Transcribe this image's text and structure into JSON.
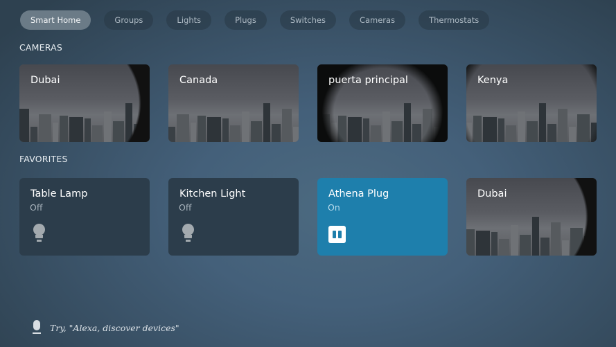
{
  "tabs": [
    {
      "label": "Smart Home",
      "active": true
    },
    {
      "label": "Groups",
      "active": false
    },
    {
      "label": "Lights",
      "active": false
    },
    {
      "label": "Plugs",
      "active": false
    },
    {
      "label": "Switches",
      "active": false
    },
    {
      "label": "Cameras",
      "active": false
    },
    {
      "label": "Thermostats",
      "active": false
    }
  ],
  "cameras": {
    "title": "CAMERAS",
    "items": [
      {
        "name": "Dubai"
      },
      {
        "name": "Canada"
      },
      {
        "name": "puerta principal"
      },
      {
        "name": "Kenya"
      }
    ]
  },
  "favorites": {
    "title": "FAVORITES",
    "items": [
      {
        "name": "Table Lamp",
        "status": "Off",
        "type": "light",
        "icon": "lightbulb-icon"
      },
      {
        "name": "Kitchen Light",
        "status": "Off",
        "type": "light",
        "icon": "lightbulb-icon"
      },
      {
        "name": "Athena Plug",
        "status": "On",
        "type": "plug",
        "icon": "plug-icon",
        "color": "#1e7fac"
      },
      {
        "name": "Dubai",
        "type": "camera"
      }
    ]
  },
  "hint": {
    "icon": "microphone-icon",
    "text": "Try, \"Alexa, discover devices\""
  }
}
